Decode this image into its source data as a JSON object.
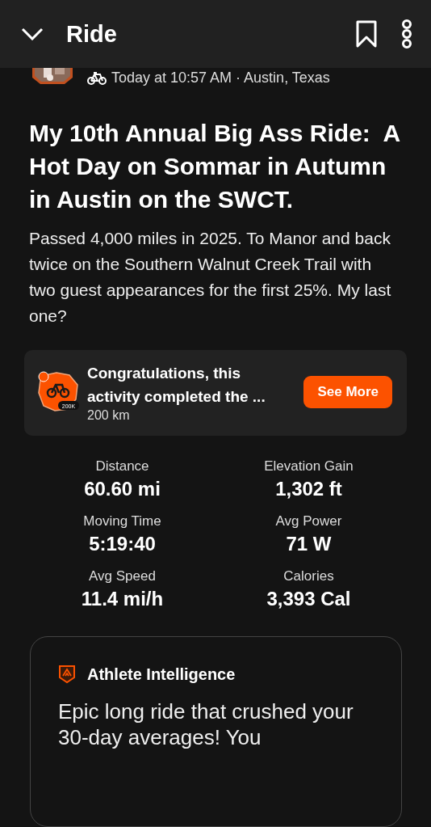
{
  "header": {
    "title": "Ride"
  },
  "activity": {
    "meta": "Today at 10:57 AM · Austin, Texas",
    "title": "My 10th Annual Big Ass Ride:  A Hot Day on Sommar in Autumn in Austin on the SWCT.",
    "description": "Passed 4,000 miles in 2025. To Manor and back twice on the Southern Walnut Creek Trail with two guest appearances for the first 25%. My last one?"
  },
  "achievement": {
    "badge_label": "200K",
    "title": "Congratulations, this activity completed the ...",
    "subtitle": "200 km",
    "button": "See More"
  },
  "stats": [
    {
      "label": "Distance",
      "value": "60.60 mi"
    },
    {
      "label": "Elevation Gain",
      "value": "1,302 ft"
    },
    {
      "label": "Moving Time",
      "value": "5:19:40"
    },
    {
      "label": "Avg Power",
      "value": "71 W"
    },
    {
      "label": "Avg Speed",
      "value": "11.4 mi/h"
    },
    {
      "label": "Calories",
      "value": "3,393 Cal"
    }
  ],
  "insight": {
    "title": "Athlete Intelligence",
    "text": "Epic long ride that crushed your 30-day averages! You"
  }
}
